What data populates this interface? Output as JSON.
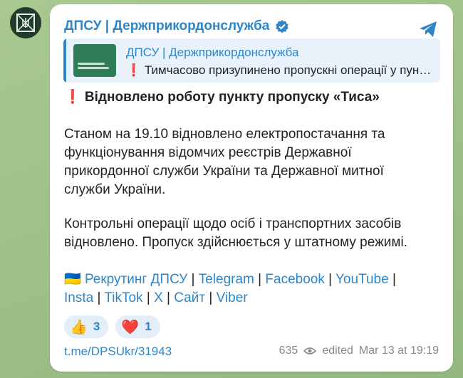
{
  "channel": {
    "name": "ДПСУ | Держприкордонслужба",
    "avatar_icon": "border-guard-emblem-icon",
    "verified_icon": "verified-check-icon"
  },
  "reply": {
    "title": "ДПСУ | Держприкордонслужба",
    "text": "❗ Тимчасово призупинено пропускні операції у пун…"
  },
  "message": {
    "title": "❗ Відновлено роботу пункту пропуску «Тиса»",
    "para1_lines": [
      "Станом на 19.10 відновлено електропостачання та",
      "функціонування відомчих реєстрів Державної",
      "прикордонної служби України та Державної митної",
      "служби України."
    ],
    "para2_lines": [
      "Контрольні операції щодо осіб і транспортних засобів",
      "відновлено. Пропуск здійснюється у штатному режимі."
    ],
    "links_prefix": "🇺🇦",
    "links": [
      {
        "label": "Рекрутинг ДПСУ"
      },
      {
        "label": "Telegram"
      },
      {
        "label": "Facebook"
      },
      {
        "label": "YouTube"
      },
      {
        "label": "Insta"
      },
      {
        "label": "TikTok"
      },
      {
        "label": "X"
      },
      {
        "label": "Сайт"
      },
      {
        "label": "Viber"
      }
    ]
  },
  "reactions": [
    {
      "emoji": "👍",
      "count": "3"
    },
    {
      "emoji": "❤️",
      "count": "1"
    }
  ],
  "footer": {
    "link": "t.me/DPSUkr/31943",
    "views": "635",
    "edited": "edited",
    "timestamp": "Mar 13 at 19:19"
  },
  "colors": {
    "accent": "#2f86c7",
    "bubble": "#ffffff",
    "background": "#9fc08a"
  }
}
